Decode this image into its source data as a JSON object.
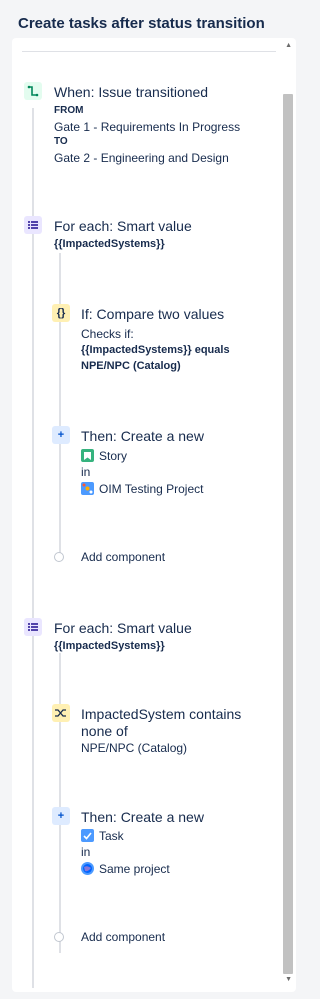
{
  "header": {
    "title": "Create tasks after status transition"
  },
  "trigger": {
    "heading": "When: Issue transitioned",
    "from_label": "FROM",
    "from_value": "Gate 1 - Requirements In Progress",
    "to_label": "TO",
    "to_value": "Gate 2 - Engineering and Design"
  },
  "branch1": {
    "heading": "For each: Smart value",
    "value": "{{ImpactedSystems}}",
    "condition": {
      "heading": "If: Compare two values",
      "checks": "Checks if:",
      "expr_line1": "{{ImpactedSystems}} equals",
      "expr_line2": "NPE/NPC (Catalog)"
    },
    "action": {
      "heading": "Then: Create a new",
      "issue_type": "Story",
      "in": "in",
      "project": "OIM Testing Project"
    },
    "add_component": "Add component"
  },
  "branch2": {
    "heading": "For each: Smart value",
    "value": "{{ImpactedSystems}}",
    "condition": {
      "heading_line1": "ImpactedSystem contains",
      "heading_line2": "none of",
      "value": "NPE/NPC (Catalog)"
    },
    "action": {
      "heading": "Then: Create a new",
      "issue_type": "Task",
      "in": "in",
      "project": "Same project"
    },
    "add_component": "Add component"
  },
  "colors": {
    "trigger_green": "#00875a",
    "branch_purple": "#5243aa",
    "condition_yellow": "#fff0b3",
    "action_blue": "#0052cc",
    "story_green": "#36b37e",
    "task_blue": "#4c9aff"
  },
  "icons": {
    "trigger": "trigger-icon",
    "branch": "branch-list-icon",
    "condition": "curly-braces-icon",
    "condition2": "shuffle-icon",
    "action": "plus-icon",
    "story": "story-bookmark-icon",
    "task": "task-checkbox-icon",
    "project1": "project-avatar-icon",
    "project2": "globe-avatar-icon"
  }
}
